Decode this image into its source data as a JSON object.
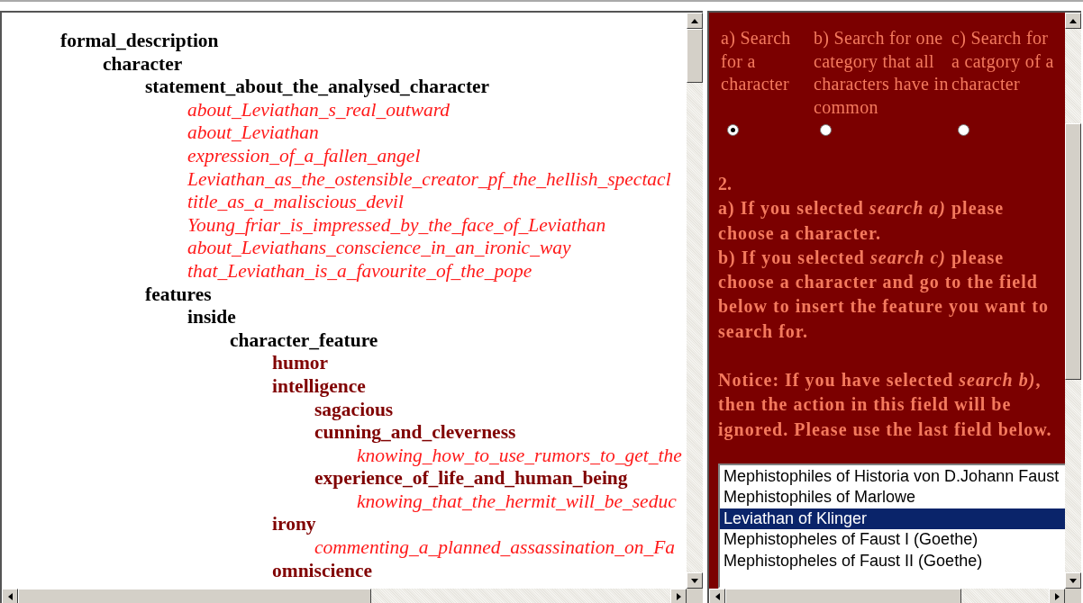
{
  "tree": [
    {
      "kind": "heading",
      "text": "formal_description",
      "children": [
        {
          "kind": "heading",
          "text": "character",
          "children": [
            {
              "kind": "heading",
              "text": "statement_about_the_analysed_character",
              "children": [
                {
                  "kind": "statement",
                  "text": "about_Leviathan_s_real_outward"
                },
                {
                  "kind": "statement",
                  "text": "about_Leviathan"
                },
                {
                  "kind": "statement",
                  "text": "expression_of_a_fallen_angel"
                },
                {
                  "kind": "statement",
                  "text": "Leviathan_as_the_ostensible_creator_pf_the_hellish_spectacl"
                },
                {
                  "kind": "statement",
                  "text": "title_as_a_maliscious_devil"
                },
                {
                  "kind": "statement",
                  "text": "Young_friar_is_impressed_by_the_face_of_Leviathan"
                },
                {
                  "kind": "statement",
                  "text": "about_Leviathans_conscience_in_an_ironic_way"
                },
                {
                  "kind": "statement",
                  "text": "that_Leviathan_is_a_favourite_of_the_pope"
                }
              ]
            },
            {
              "kind": "heading",
              "text": "features",
              "children": [
                {
                  "kind": "heading",
                  "text": "inside",
                  "children": [
                    {
                      "kind": "heading",
                      "text": "character_feature",
                      "children": [
                        {
                          "kind": "category",
                          "text": "humor"
                        },
                        {
                          "kind": "category",
                          "text": "intelligence",
                          "children": [
                            {
                              "kind": "category",
                              "text": "sagacious"
                            },
                            {
                              "kind": "category",
                              "text": "cunning_and_cleverness",
                              "children": [
                                {
                                  "kind": "statement",
                                  "text": "knowing_how_to_use_rumors_to_get_the"
                                }
                              ]
                            },
                            {
                              "kind": "category",
                              "text": "experience_of_life_and_human_being",
                              "children": [
                                {
                                  "kind": "statement",
                                  "text": "knowing_that_the_hermit_will_be_seduc"
                                }
                              ]
                            }
                          ]
                        },
                        {
                          "kind": "category",
                          "text": "irony",
                          "children": [
                            {
                              "kind": "statement",
                              "text": "commenting_a_planned_assassination_on_Fa"
                            }
                          ]
                        },
                        {
                          "kind": "category",
                          "text": "omniscience"
                        }
                      ]
                    }
                  ]
                }
              ]
            }
          ]
        }
      ]
    }
  ],
  "search_options": [
    {
      "label": "a) Search for a character",
      "selected": true
    },
    {
      "label": "b) Search for one category that all characters have in common",
      "selected": false
    },
    {
      "label": "c) Search for a catgory of a character",
      "selected": false
    }
  ],
  "step_number": "2.",
  "instructions": [
    "a) If you selected *search a)* please choose a character.",
    "b) If you selected *search c)* please choose a character and go to the field below to insert the feature you want to search for."
  ],
  "notice": "Notice: If you have selected *search b)*, then the action in this field will be ignored. Please use the last field below.",
  "characters": [
    {
      "text": "Mephistophiles of Historia von D.Johann Faust",
      "selected": false
    },
    {
      "text": "Mephistophiles of Marlowe",
      "selected": false
    },
    {
      "text": "Leviathan of Klinger",
      "selected": true
    },
    {
      "text": "Mephistopheles of Faust I (Goethe)",
      "selected": false
    },
    {
      "text": "Mephistopheles of Faust II (Goethe)",
      "selected": false
    }
  ]
}
